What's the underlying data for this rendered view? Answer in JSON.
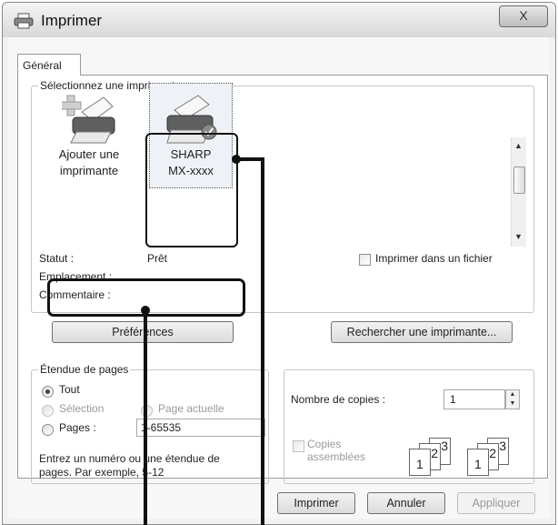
{
  "window": {
    "title": "Imprimer",
    "close_glyph": "X"
  },
  "tabs": [
    {
      "label": "Général"
    }
  ],
  "printer_group": {
    "label": "Sélectionnez une imprimante",
    "printers": [
      {
        "line1": "Ajouter une",
        "line2": "imprimante",
        "icon": "add-printer-icon"
      },
      {
        "line1": "SHARP",
        "line2": "MX-xxxx",
        "icon": "printer-icon",
        "selected": true
      }
    ],
    "status_label": "Statut :",
    "status_value": "Prêt",
    "location_label": "Emplacement :",
    "comment_label": "Commentaire :",
    "print_to_file_label": "Imprimer dans un fichier",
    "preferences_button": "Préférences",
    "find_printer_button": "Rechercher une imprimante..."
  },
  "range_group": {
    "label": "Étendue de pages",
    "options": {
      "all": "Tout",
      "selection": "Sélection",
      "current_page": "Page actuelle",
      "pages": "Pages :"
    },
    "selected_option": "Tout",
    "pages_value": "1-65535",
    "hint_line1": "Entrez un numéro ou une étendue de",
    "hint_line2": "pages. Par exemple, 5-12"
  },
  "copies_group": {
    "copies_label": "Nombre de copies :",
    "copies_value": "1",
    "collate_label_line1": "Copies",
    "collate_label_line2": "assemblées",
    "collate_icon_digits": [
      "1",
      "2",
      "3"
    ]
  },
  "footer": {
    "print_button": "Imprimer",
    "cancel_button": "Annuler",
    "apply_button": "Appliquer"
  }
}
